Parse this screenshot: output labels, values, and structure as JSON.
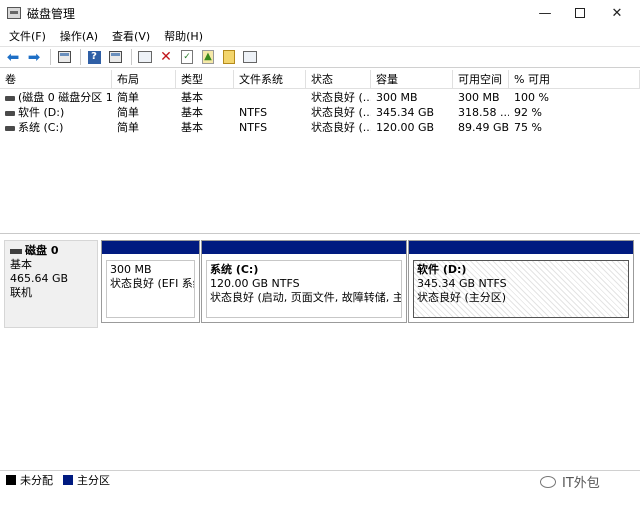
{
  "window": {
    "title": "磁盘管理",
    "minimize": "—",
    "maximize": "",
    "close": "✕"
  },
  "menu": [
    "文件(F)",
    "操作(A)",
    "查看(V)",
    "帮助(H)"
  ],
  "toolbar": {
    "icons": [
      "back-arrow-icon",
      "forward-arrow-icon",
      "console-tree-icon",
      "help-icon",
      "show-hide-icon",
      "connect-icon",
      "delete-icon",
      "check-icon",
      "rescan-icon",
      "wizard-icon",
      "properties-icon"
    ]
  },
  "table": {
    "headers": [
      "卷",
      "布局",
      "类型",
      "文件系统",
      "状态",
      "容量",
      "可用空间",
      "% 可用"
    ],
    "rows": [
      [
        "(磁盘 0 磁盘分区 1)",
        "简单",
        "基本",
        "",
        "状态良好 (...",
        "300 MB",
        "300 MB",
        "100 %"
      ],
      [
        "软件 (D:)",
        "简单",
        "基本",
        "NTFS",
        "状态良好 (...",
        "345.34 GB",
        "318.58 ...",
        "92 %"
      ],
      [
        "系统 (C:)",
        "简单",
        "基本",
        "NTFS",
        "状态良好 (...",
        "120.00 GB",
        "89.49 GB",
        "75 %"
      ]
    ]
  },
  "disk": {
    "name": "磁盘 0",
    "type": "基本",
    "size": "465.64 GB",
    "status": "联机",
    "partitions": [
      {
        "title": "",
        "size": "300 MB",
        "status": "状态良好 (EFI 系统分"
      },
      {
        "title": "系统 (C:)",
        "size": "120.00 GB NTFS",
        "status": "状态良好 (启动, 页面文件, 故障转储, 主分区"
      },
      {
        "title": "软件 (D:)",
        "size": "345.34 GB NTFS",
        "status": "状态良好 (主分区)"
      }
    ]
  },
  "legend": [
    "未分配",
    "主分区"
  ],
  "watermark": "IT外包",
  "colors": {
    "primary_partition": "#001a80",
    "unallocated": "#000000"
  }
}
